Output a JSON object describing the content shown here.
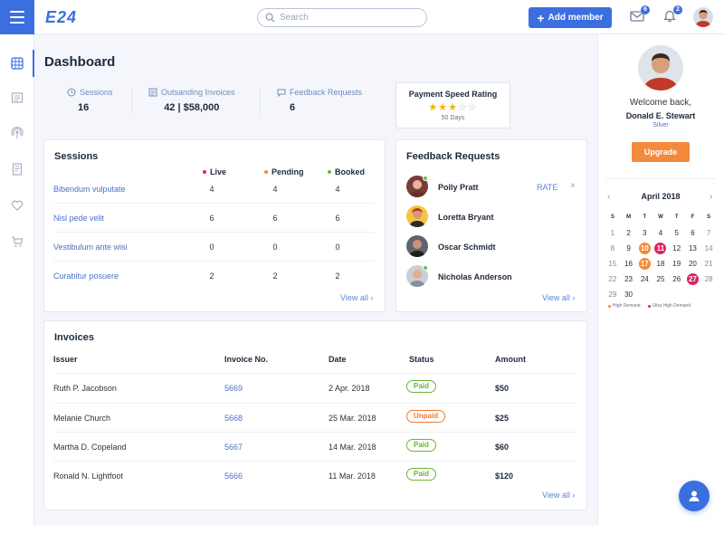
{
  "header": {
    "logo": "E24",
    "search_placeholder": "Search",
    "add_member_label": "Add member",
    "mail_badge": "6",
    "bell_badge": "2"
  },
  "page": {
    "title": "Dashboard"
  },
  "stats": [
    {
      "label": "Sessions",
      "value": "16",
      "icon": "clock-icon"
    },
    {
      "label": "Outsanding Invoices",
      "value": "42 | $58,000",
      "icon": "invoice-icon"
    },
    {
      "label": "Feedback Requests",
      "value": "6",
      "icon": "feedback-icon"
    }
  ],
  "rating": {
    "title": "Payment Speed Rating",
    "stars": 3,
    "max": 5,
    "sub": "50 Days"
  },
  "sessions": {
    "title": "Sessions",
    "legend": [
      {
        "label": "Live",
        "color": "#e0245e"
      },
      {
        "label": "Pending",
        "color": "#f38a3b"
      },
      {
        "label": "Booked",
        "color": "#6bb43a"
      }
    ],
    "rows": [
      {
        "name": "Bibendum vulputate",
        "live": "4",
        "pending": "4",
        "booked": "4"
      },
      {
        "name": "Nisl pede velit",
        "live": "6",
        "pending": "6",
        "booked": "6"
      },
      {
        "name": "Vestibulum ante wisi",
        "live": "0",
        "pending": "0",
        "booked": "0"
      },
      {
        "name": "Curabitur posuere",
        "live": "2",
        "pending": "2",
        "booked": "2"
      }
    ],
    "view_all": "View all ›"
  },
  "feedback": {
    "title": "Feedback Requests",
    "rate_label": "RATE",
    "close": "×",
    "rows": [
      {
        "name": "Polly Pratt",
        "online": true
      },
      {
        "name": "Loretta Bryant",
        "online": false
      },
      {
        "name": "Oscar Schmidt",
        "online": false
      },
      {
        "name": "Nicholas Anderson",
        "online": true
      }
    ],
    "view_all": "View all ›"
  },
  "invoices": {
    "title": "Invoices",
    "headers": {
      "issuer": "Issuer",
      "no": "Invoice No.",
      "date": "Date",
      "status": "Status",
      "amount": "Amount"
    },
    "rows": [
      {
        "issuer": "Ruth P. Jacobson",
        "no": "5669",
        "date": "2 Apr. 2018",
        "status": "Paid",
        "amount": "$50"
      },
      {
        "issuer": "Melanie Church",
        "no": "5668",
        "date": "25 Mar. 2018",
        "status": "Unpaid",
        "amount": "$25"
      },
      {
        "issuer": "Martha D. Copeland",
        "no": "5667",
        "date": "14 Mar. 2018",
        "status": "Paid",
        "amount": "$60"
      },
      {
        "issuer": "Ronald N. Lightfoot",
        "no": "5666",
        "date": "11 Mar. 2018",
        "status": "Paid",
        "amount": "$120"
      }
    ],
    "view_all": "View all ›"
  },
  "profile": {
    "welcome": "Welcome back,",
    "name": "Donald E. Stewart",
    "tier": "Silver",
    "upgrade": "Upgrade"
  },
  "calendar": {
    "month": "April 2018",
    "prev": "‹",
    "next": "›",
    "weekdays": [
      "S",
      "M",
      "T",
      "W",
      "T",
      "F",
      "S"
    ],
    "days": [
      "1",
      "2",
      "3",
      "4",
      "5",
      "6",
      "7",
      "8",
      "9",
      "10",
      "11",
      "12",
      "13",
      "14",
      "15",
      "16",
      "17",
      "18",
      "19",
      "20",
      "21",
      "22",
      "23",
      "24",
      "25",
      "26",
      "27",
      "28",
      "29",
      "30"
    ],
    "high_demand": [
      "10",
      "17"
    ],
    "ultra_high_demand": [
      "11",
      "27"
    ],
    "legend_high": "High Demand",
    "legend_ultra": "Ultra High Demand",
    "colors": {
      "high": "#f38a3b",
      "ultra": "#e0245e"
    }
  },
  "colors": {
    "accent": "#3b6fe0",
    "link": "#4a72c4",
    "paid": "#6bb43a",
    "unpaid": "#f07a36"
  }
}
